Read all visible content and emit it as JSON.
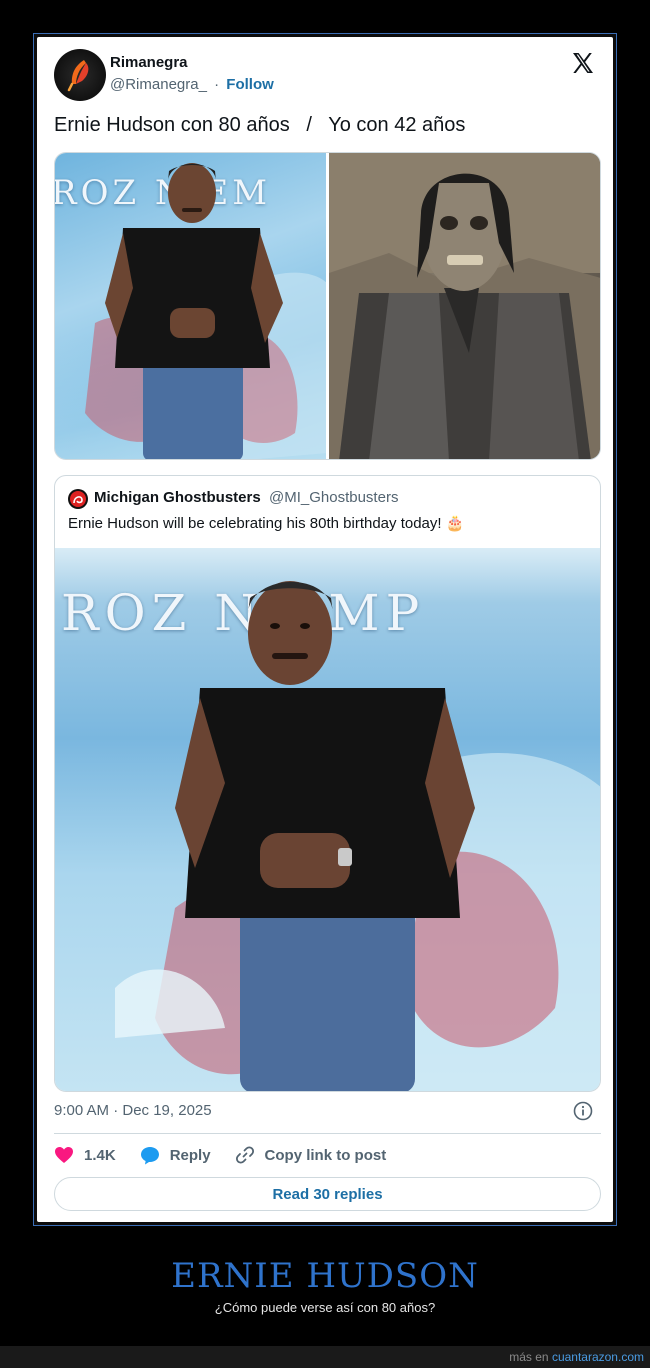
{
  "tweet": {
    "author_name": "Rimanegra",
    "author_handle": "@Rimanegra_",
    "separator": "·",
    "follow_label": "Follow",
    "text": "Ernie Hudson con 80 años   /   Yo con 42 años",
    "timestamp": "9:00 AM · Dec 19, 2025",
    "likes": "1.4K",
    "reply_label": "Reply",
    "copy_label": "Copy link to post",
    "read_replies_label": "Read 30 replies"
  },
  "quoted": {
    "author_name": "Michigan Ghostbusters",
    "author_handle": "@MI_Ghostbusters",
    "text": "Ernie Hudson will be celebrating his 80th birthday today! 🎂",
    "banner_text": "ROZ N EMP"
  },
  "images": {
    "left_banner": "ROZ N EM"
  },
  "meme": {
    "title": "ERNIE HUDSON",
    "subtitle": "¿Cómo puede verse así con 80 años?",
    "footer_prefix": "más en",
    "footer_link": "cuantarazon.com"
  },
  "colors": {
    "accent": "#1d6fa5",
    "like": "#f91880",
    "reply": "#1d9bf0",
    "title": "#2f73cc"
  }
}
